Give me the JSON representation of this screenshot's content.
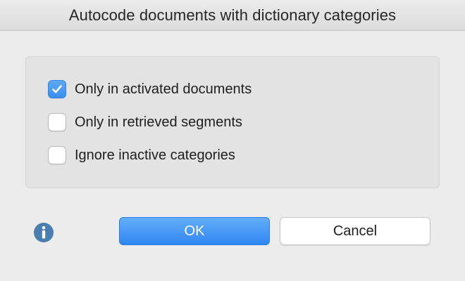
{
  "window": {
    "title": "Autocode documents with dictionary categories"
  },
  "options": [
    {
      "label": "Only in activated documents",
      "checked": true
    },
    {
      "label": "Only in retrieved segments",
      "checked": false
    },
    {
      "label": "Ignore inactive categories",
      "checked": false
    }
  ],
  "buttons": {
    "ok_label": "OK",
    "cancel_label": "Cancel"
  },
  "icons": {
    "info": "info-icon",
    "check": "checkmark-icon"
  },
  "colors": {
    "accent": "#3b8ff1",
    "info_icon": "#4a7eb0"
  }
}
